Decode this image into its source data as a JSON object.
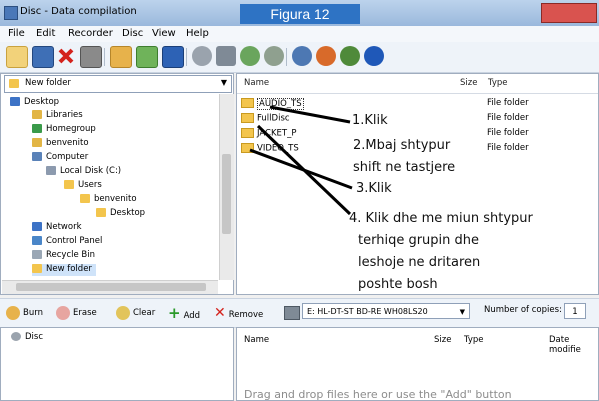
{
  "window": {
    "title": "Disc - Data compilation",
    "overlay_label": "Figura 12"
  },
  "menu": [
    "File",
    "Edit",
    "Recorder",
    "Disc",
    "View",
    "Help"
  ],
  "folder_selector": {
    "value": "New folder"
  },
  "tree": [
    {
      "label": "Desktop",
      "icon": "desktop-icon",
      "color": "#3d73c6"
    },
    {
      "label": "Libraries",
      "icon": "libraries-icon",
      "color": "#e2b545"
    },
    {
      "label": "Homegroup",
      "icon": "homegroup-icon",
      "color": "#3a9a4a"
    },
    {
      "label": "benvenito",
      "icon": "user-folder-icon",
      "color": "#e2b545"
    },
    {
      "label": "Computer",
      "icon": "computer-icon",
      "color": "#5a82b8"
    },
    {
      "label": "Local Disk (C:)",
      "icon": "drive-icon",
      "color": "#8c9aae"
    },
    {
      "label": "Users",
      "icon": "folder-icon",
      "color": "#f3c54d"
    },
    {
      "label": "benvenito",
      "icon": "folder-icon",
      "color": "#f3c54d"
    },
    {
      "label": "Desktop",
      "icon": "folder-icon",
      "color": "#f3c54d"
    },
    {
      "label": "Network",
      "icon": "network-icon",
      "color": "#3d73c6"
    },
    {
      "label": "Control Panel",
      "icon": "control-panel-icon",
      "color": "#4a86c8"
    },
    {
      "label": "Recycle Bin",
      "icon": "recycle-bin-icon",
      "color": "#9aa7b5"
    },
    {
      "label": "New folder",
      "icon": "folder-icon",
      "color": "#f3c54d"
    }
  ],
  "file_list": {
    "columns": {
      "name": "Name",
      "size": "Size",
      "type": "Type"
    },
    "rows": [
      {
        "name": "AUDIO_TS",
        "type": "File folder"
      },
      {
        "name": "FullDisc",
        "type": "File folder"
      },
      {
        "name": "JACKET_P",
        "type": "File folder"
      },
      {
        "name": "VIDEO_TS",
        "type": "File folder"
      }
    ]
  },
  "annotations": [
    "1.Klik",
    "2.Mbaj shtypur",
    "shift ne tastjere",
    "3.Klik",
    "4. Klik dhe me miun shtypur",
    "terhiqe grupin dhe",
    "leshoje ne dritaren",
    "poshte bosh"
  ],
  "disc_toolbar": {
    "burn": "Burn",
    "erase": "Erase",
    "clear": "Clear",
    "add": "Add",
    "remove": "Remove",
    "drive": "E: HL-DT-ST BD-RE  WH08LS20",
    "copies_label": "Number of copies:",
    "copies_value": "1"
  },
  "disc_tree": {
    "root": "Disc"
  },
  "disc_list": {
    "columns": {
      "name": "Name",
      "size": "Size",
      "type": "Type",
      "date": "Date modifie"
    },
    "empty_hint": "Drag and drop files here or use the \"Add\" button"
  }
}
